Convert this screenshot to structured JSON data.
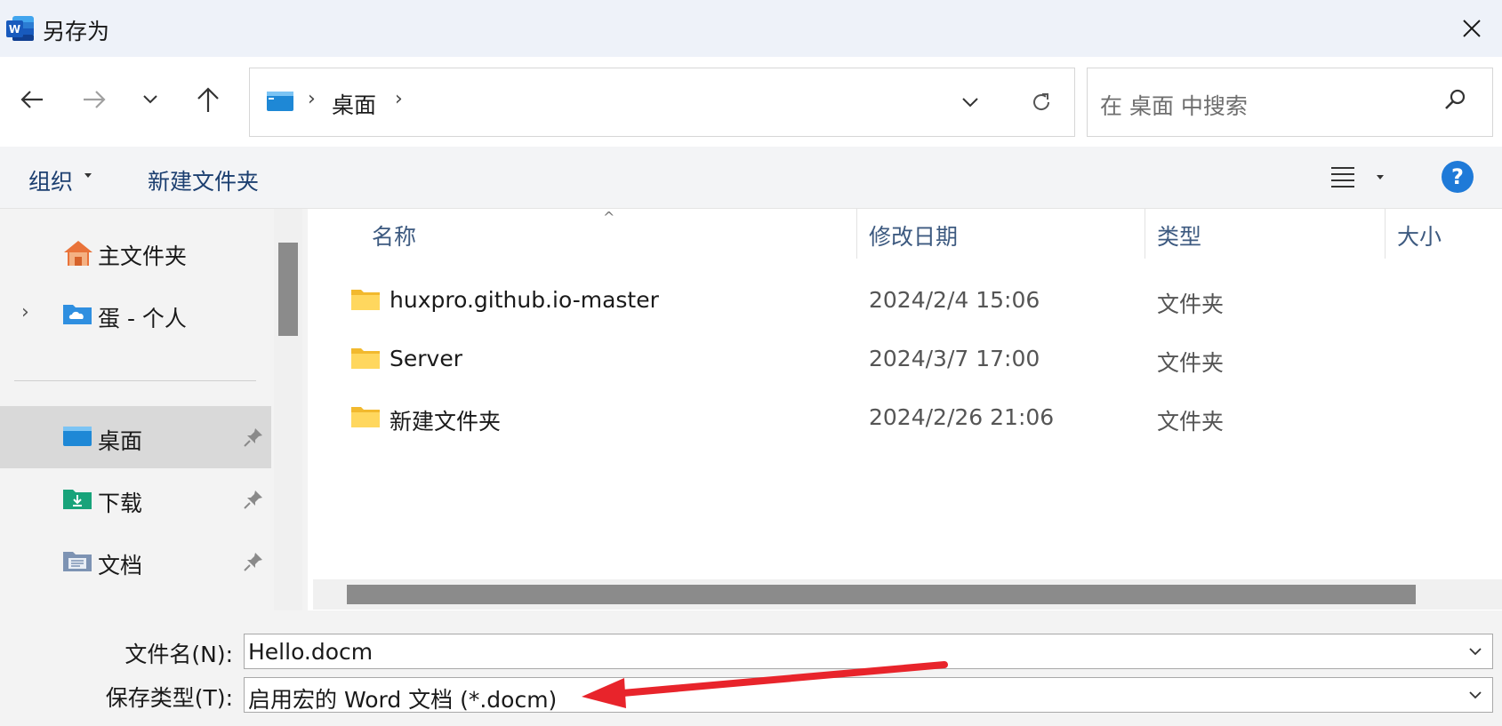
{
  "window": {
    "title": "另存为",
    "app_icon": "word-icon",
    "close_icon": "close-icon"
  },
  "navigation": {
    "back_icon": "back-arrow-icon",
    "forward_icon": "forward-arrow-icon",
    "recent_icon": "chevron-down-icon",
    "up_icon": "up-arrow-icon"
  },
  "address_bar": {
    "location_icon": "desktop-folder-icon",
    "separator": "›",
    "path": "桌面",
    "trailing_separator": "›"
  },
  "search": {
    "placeholder": "在 桌面 中搜索",
    "icon": "search-icon"
  },
  "toolbar": {
    "organize_label": "组织",
    "new_folder_label": "新建文件夹",
    "view_icon": "list-view-icon",
    "help_label": "?"
  },
  "sidebar": {
    "items": [
      {
        "label": "主文件夹",
        "icon": "home-icon",
        "expandable": false,
        "pinned": false
      },
      {
        "label": "蛋 - 个人",
        "icon": "onedrive-folder-icon",
        "expandable": true,
        "expand_glyph": "›",
        "pinned": false
      },
      {
        "label": "桌面",
        "icon": "desktop-folder-icon",
        "pinned": true,
        "selected": true
      },
      {
        "label": "下载",
        "icon": "downloads-folder-icon",
        "pinned": true
      },
      {
        "label": "文档",
        "icon": "documents-folder-icon",
        "pinned": true
      }
    ]
  },
  "file_list": {
    "columns": [
      "名称",
      "修改日期",
      "类型",
      "大小"
    ],
    "sort_indicator": "^",
    "rows": [
      {
        "name": "huxpro.github.io-master",
        "modified": "2024/2/4 15:06",
        "type": "文件夹",
        "size": ""
      },
      {
        "name": "Server",
        "modified": "2024/3/7 17:00",
        "type": "文件夹",
        "size": ""
      },
      {
        "name": "新建文件夹",
        "modified": "2024/2/26 21:06",
        "type": "文件夹",
        "size": ""
      }
    ]
  },
  "save_form": {
    "filename_label": "文件名(N):",
    "filename_value": "Hello.docm",
    "filetype_label": "保存类型(T):",
    "filetype_value": "启用宏的 Word 文档 (*.docm)"
  },
  "colors": {
    "annotation_arrow": "#e8242b",
    "selected_bg": "#d9d9d9",
    "help_blue": "#1f7ad8"
  }
}
